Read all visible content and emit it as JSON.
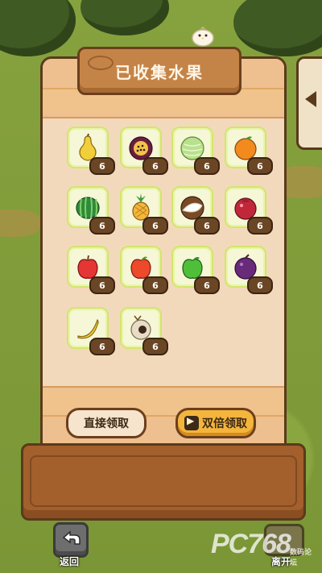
{
  "title": "已收集水果",
  "fruits": [
    {
      "name": "pear",
      "count": "6"
    },
    {
      "name": "passion-fruit",
      "count": "6"
    },
    {
      "name": "melon",
      "count": "6"
    },
    {
      "name": "orange",
      "count": "6"
    },
    {
      "name": "watermelon",
      "count": "6"
    },
    {
      "name": "pineapple",
      "count": "6"
    },
    {
      "name": "coconut",
      "count": "6"
    },
    {
      "name": "pomegranate",
      "count": "6"
    },
    {
      "name": "red-apple",
      "count": "6"
    },
    {
      "name": "red-apple-2",
      "count": "6"
    },
    {
      "name": "green-apple",
      "count": "6"
    },
    {
      "name": "plum",
      "count": "6"
    },
    {
      "name": "banana",
      "count": "6"
    },
    {
      "name": "longan",
      "count": "6"
    }
  ],
  "buttons": {
    "direct": "直接领取",
    "double": "双倍领取"
  },
  "nav": {
    "back": "返回",
    "leave": "离开"
  },
  "watermark": {
    "brand": "PC768",
    "sub": "数码论坛"
  },
  "colors": {
    "panel": "#f3d9bb",
    "panel_border": "#5a3a1b",
    "tile_border": "#d2e56f",
    "badge": "#6b4625",
    "accent_button": "#f4b53d"
  },
  "icons": {
    "back": "return-arrow-icon",
    "double_button": "video-play-icon",
    "side": "chevron-left-icon",
    "mascot": "chick-icon"
  }
}
